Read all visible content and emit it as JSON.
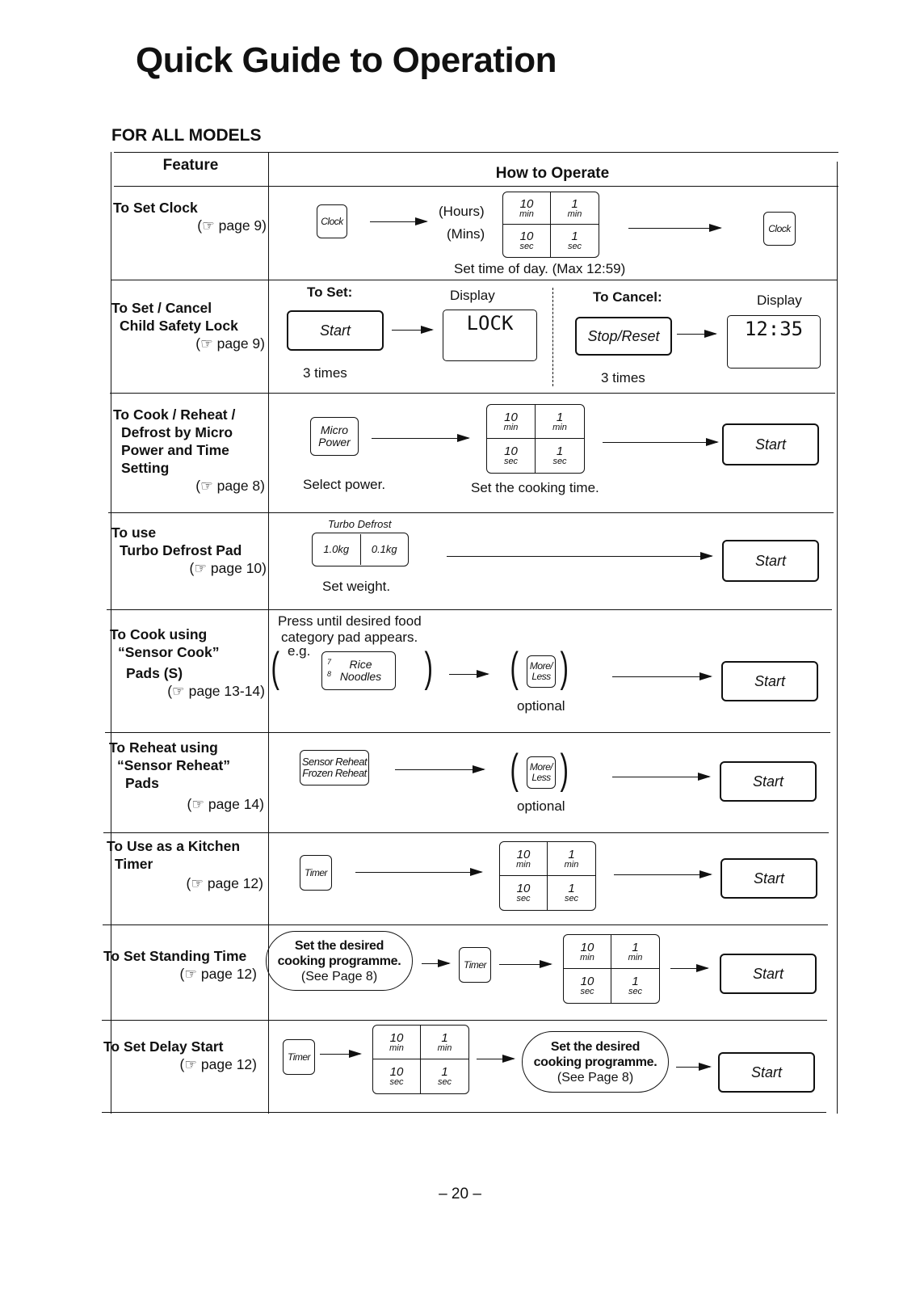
{
  "page": {
    "title": "Quick Guide to Operation",
    "subtitle": "FOR ALL MODELS",
    "page_number": "– 20 –"
  },
  "table": {
    "headers": {
      "feature": "Feature",
      "operate": "How to Operate"
    },
    "ref_icon": "pointing-hand-icon",
    "rows": [
      {
        "feature": [
          "To Set Clock"
        ],
        "ref": "(☞ page 9)",
        "steps": {
          "clock_key": "Clock",
          "hours_label": "(Hours)",
          "mins_label": "(Mins)",
          "caption": "Set time of day. (Max 12:59)",
          "clock_key_end": "Clock"
        }
      },
      {
        "feature": [
          "To Set / Cancel",
          "Child Safety Lock"
        ],
        "ref": "(☞ page 9)",
        "steps": {
          "set_label": "To Set:",
          "set_key": "Start",
          "set_times": "3 times",
          "display_label": "Display",
          "set_display": "LOCK",
          "cancel_label": "To Cancel:",
          "cancel_key": "Stop/Reset",
          "cancel_times": "3 times",
          "display_label2": "Display",
          "cancel_display": "12:35"
        }
      },
      {
        "feature": [
          "To Cook / Reheat /",
          "Defrost by Micro",
          "Power and Time",
          "Setting"
        ],
        "ref": "(☞ page 8)",
        "steps": {
          "power_key": [
            "Micro",
            "Power"
          ],
          "power_caption": "Select power.",
          "time_caption": "Set the cooking time.",
          "start": "Start"
        }
      },
      {
        "feature": [
          "To use",
          "Turbo Defrost Pad"
        ],
        "ref": "(☞ page 10)",
        "steps": {
          "pad_title": "Turbo Defrost",
          "pad_left": "1.0kg",
          "pad_right": "0.1kg",
          "caption": "Set weight.",
          "start": "Start"
        }
      },
      {
        "feature": [
          "To Cook using",
          "“Sensor Cook”",
          "Pads (S)"
        ],
        "ref": "(☞ page 13-14)",
        "steps": {
          "instruction": [
            "Press until desired food",
            "category pad appears."
          ],
          "eg": "e.g.",
          "pad_line1_num": "7",
          "pad_line1": "Rice",
          "pad_line2_num": "8",
          "pad_line2": "Noodles",
          "more_less": [
            "More/",
            "Less"
          ],
          "optional": "optional",
          "start": "Start"
        }
      },
      {
        "feature": [
          "To Reheat using",
          "“Sensor Reheat”",
          "Pads"
        ],
        "ref": "(☞ page 14)",
        "steps": {
          "pad": [
            "Sensor Reheat",
            "Frozen Reheat"
          ],
          "more_less": [
            "More/",
            "Less"
          ],
          "optional": "optional",
          "start": "Start"
        }
      },
      {
        "feature": [
          "To Use as a Kitchen",
          "Timer"
        ],
        "ref": "(☞ page 12)",
        "steps": {
          "timer_key": "Timer",
          "start": "Start"
        }
      },
      {
        "feature": [
          "To Set Standing Time"
        ],
        "ref": "(☞ page 12)",
        "steps": {
          "oval": [
            "Set the desired",
            "cooking programme.",
            "(See Page 8)"
          ],
          "timer_key": "Timer",
          "start": "Start"
        }
      },
      {
        "feature": [
          "To Set Delay Start"
        ],
        "ref": "(☞ page 12)",
        "steps": {
          "timer_key": "Timer",
          "oval": [
            "Set the desired",
            "cooking programme.",
            "(See Page 8)"
          ],
          "start": "Start"
        }
      }
    ],
    "time_pad": [
      {
        "num": "10",
        "unit": "min"
      },
      {
        "num": "1",
        "unit": "min"
      },
      {
        "num": "10",
        "unit": "sec"
      },
      {
        "num": "1",
        "unit": "sec"
      }
    ]
  }
}
